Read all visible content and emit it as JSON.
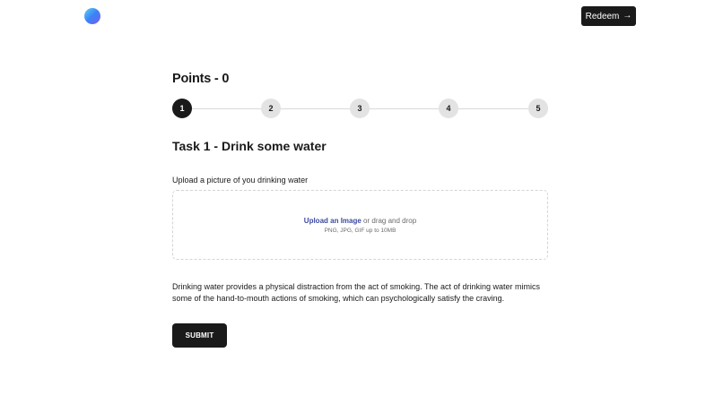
{
  "header": {
    "logo_icon": "gradient-circle-logo-icon",
    "redeem_label": "Redeem",
    "redeem_icon": "arrow-right-icon"
  },
  "points": {
    "title": "Points - 0"
  },
  "stepper": {
    "steps": [
      "1",
      "2",
      "3",
      "4",
      "5"
    ],
    "active_step": 1
  },
  "task": {
    "title": "Task 1 - Drink some water",
    "upload_label": "Upload a picture of you drinking water",
    "upload_link": "Upload an Image",
    "upload_text": " or drag and drop",
    "upload_hint": "PNG, JPG, GIF up to 10MB",
    "description": "Drinking water provides a physical distraction from the act of smoking. The act of drinking water mimics some of the hand-to-mouth actions of smoking, which can psychologically satisfy the craving.",
    "submit_label": "SUBMIT"
  },
  "colors": {
    "primary": "#1a1a1a",
    "link": "#3b4aa0",
    "step_inactive": "#e3e3e3"
  }
}
